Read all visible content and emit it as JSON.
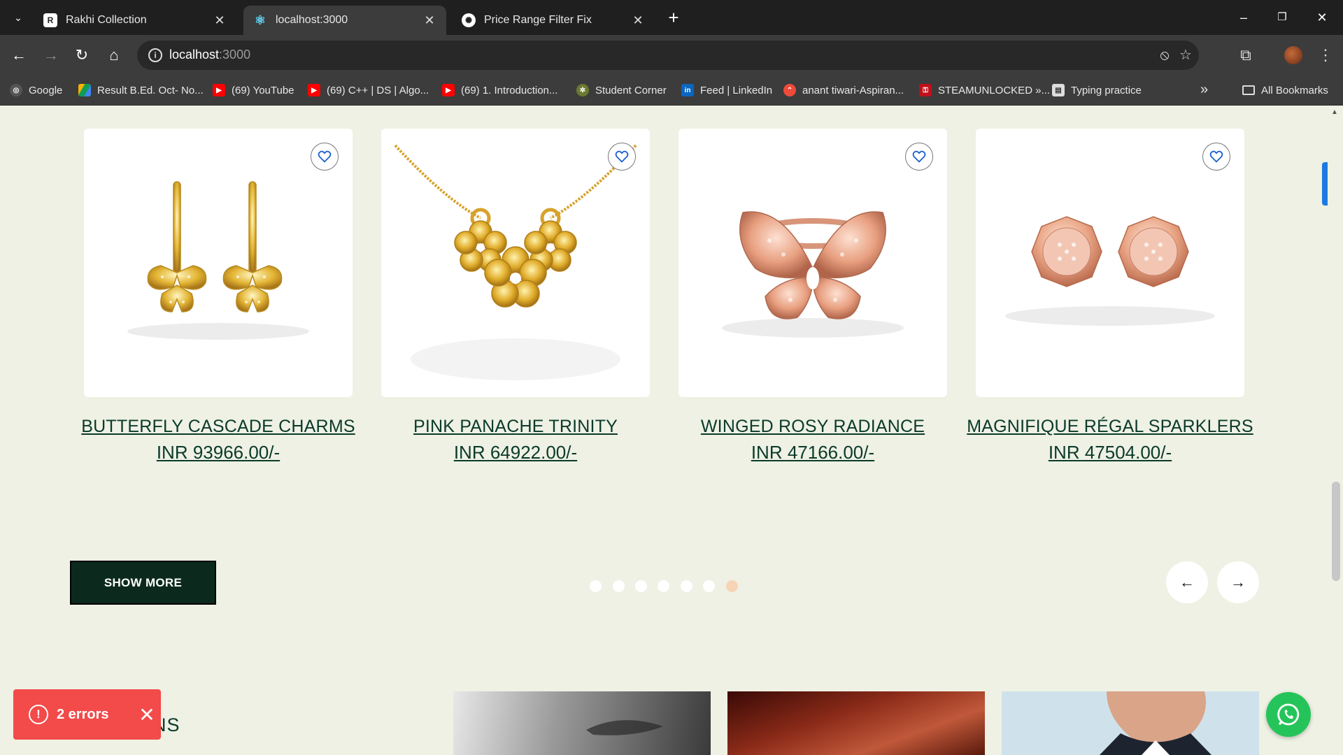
{
  "browser": {
    "tabs": [
      {
        "title": "Rakhi Collection",
        "active": false
      },
      {
        "title": "localhost:3000",
        "active": true
      },
      {
        "title": "Price Range Filter Fix",
        "active": false
      }
    ],
    "url_host": "localhost",
    "url_port": ":3000",
    "bookmarks": [
      "Google",
      "Result B.Ed. Oct- No...",
      "(69) YouTube",
      "(69) C++ | DS | Algo...",
      "(69) 1. Introduction...",
      "Student Corner",
      "Feed | LinkedIn",
      "anant tiwari-Aspiran...",
      "STEAMUNLOCKED »...",
      "Typing practice"
    ],
    "all_bookmarks": "All Bookmarks"
  },
  "products": [
    {
      "name": "BUTTERFLY CASCADE CHARMS",
      "price": "INR 93966.00/-",
      "image": "gold-butterfly-earrings"
    },
    {
      "name": "PINK PANACHE TRINITY",
      "price": "INR 64922.00/-",
      "image": "gold-flower-pendant-necklace"
    },
    {
      "name": "WINGED ROSY RADIANCE",
      "price": "INR 47166.00/-",
      "image": "rose-gold-butterfly-ring"
    },
    {
      "name": "MAGNIFIQUE RÉGAL SPARKLERS",
      "price": "INR 47504.00/-",
      "image": "rose-gold-octagon-studs"
    }
  ],
  "carousel": {
    "dot_count": 7,
    "active_index": 6
  },
  "show_more_label": "SHOW MORE",
  "section_heading_fragment": "NS",
  "error_toast": {
    "label": "2 errors"
  },
  "colors": {
    "accent": "#0b2a1d",
    "text": "#0b3a2a",
    "page_bg": "#eef1e4",
    "toast": "#f34a4a",
    "dot_active": "#f8d4b6",
    "whatsapp": "#25c45a"
  }
}
